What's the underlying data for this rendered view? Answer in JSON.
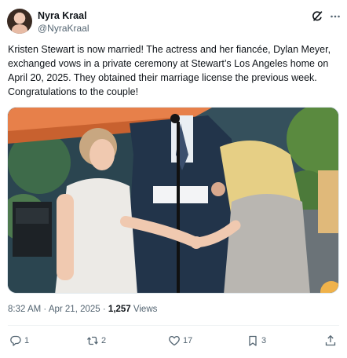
{
  "author": {
    "name": "Nyra Kraal",
    "handle": "@NyraKraal"
  },
  "header_icons": [
    "grok-icon",
    "more-icon"
  ],
  "tweet": {
    "text": "Kristen Stewart is now married! The actress and her fiancée, Dylan Meyer, exchanged vows in a private ceremony at Stewart’s Los Angeles home on April 20, 2025. They obtained their marriage license the previous week. Congratulations to the couple!"
  },
  "meta": {
    "time": "8:32 AM",
    "separator": "·",
    "date": "Apr 21, 2025",
    "separator2": "·",
    "views_count": "1,257",
    "views_label": "Views"
  },
  "actions": {
    "reply_count": "1",
    "retweet_count": "2",
    "like_count": "17",
    "bookmark_count": "3"
  },
  "colors": {
    "text": "#0f1419",
    "secondary": "#536471",
    "divider": "#eff3f4"
  }
}
